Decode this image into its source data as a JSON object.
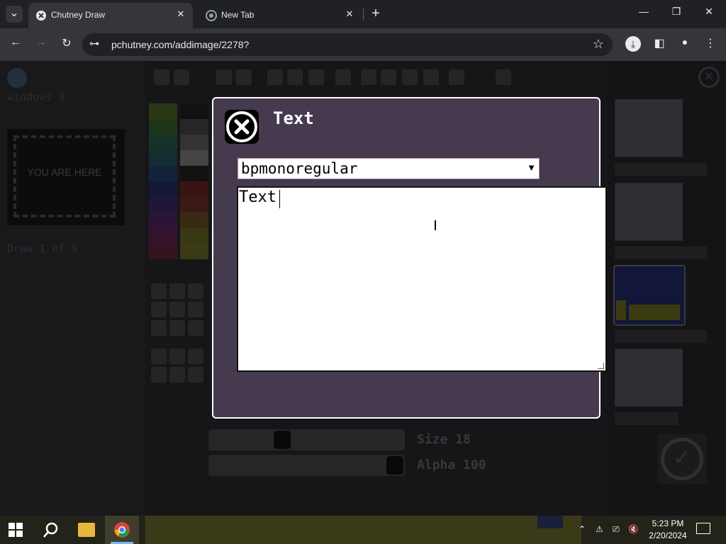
{
  "browser": {
    "tabs": [
      {
        "title": "Chutney Draw",
        "active": true,
        "icon": "chutney-favicon-icon"
      },
      {
        "title": "New Tab",
        "active": false,
        "icon": "chrome-favicon-icon"
      }
    ],
    "url": "pchutney.com/addimage/2278?",
    "icons": {
      "back": "←",
      "forward": "→",
      "reload": "↻",
      "site_info": "⊶",
      "star": "☆",
      "download": "⤓",
      "side_panel": "◧",
      "profile": "●",
      "menu": "⋮",
      "new_tab": "+",
      "tab_search": "⌄",
      "minimize": "—",
      "restore": "❐",
      "close": "✕"
    }
  },
  "page": {
    "left": {
      "room_name": "windows 9",
      "placeholder": "YOU ARE HERE",
      "draw_progress": "Draw 1 of 9"
    },
    "sliders": {
      "size_label": "Size 18",
      "size_value": 18,
      "alpha_label": "Alpha 100",
      "alpha_value": 100
    },
    "palette_colors": [
      "#2e3a14",
      "#2a2a2a",
      "#1c3a1c",
      "#3a3a3a",
      "#143a3a",
      "#4a4a4a",
      "#142a3a",
      "#5a5a5a",
      "#141a3a",
      "#3a1414",
      "#221438",
      "#3a2414",
      "#32143a",
      "#3a3a14"
    ]
  },
  "dialog": {
    "title": "Text",
    "font_selected": "bpmonoregular",
    "text_value": "Text",
    "close_icon": "close-circle-icon"
  },
  "taskbar": {
    "time": "5:23 PM",
    "date": "2/20/2024"
  }
}
